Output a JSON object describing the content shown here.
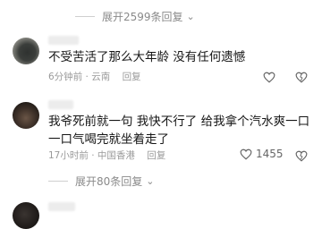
{
  "expand_top": {
    "label": "展开2599条回复"
  },
  "comments": [
    {
      "text": "不受苦活了那么大年龄 没有任何遗憾",
      "time": "6分钟前",
      "location": "云南",
      "reply_label": "回复"
    },
    {
      "text_line1": "我爷死前就一句 我快不行了 给我拿个汽水爽一口",
      "text_line2": "一口气喝完就坐着走了",
      "time": "17小时前",
      "location": "中国香港",
      "reply_label": "回复",
      "likes": "1455"
    }
  ],
  "expand_bottom": {
    "label": "展开80条回复"
  },
  "icons": {
    "expand": "chevron-down-icon",
    "like": "heart-icon",
    "dislike": "broken-heart-icon"
  },
  "colors": {
    "text": "#161616",
    "meta": "#9a9a9a",
    "link": "#8a8a8a"
  }
}
